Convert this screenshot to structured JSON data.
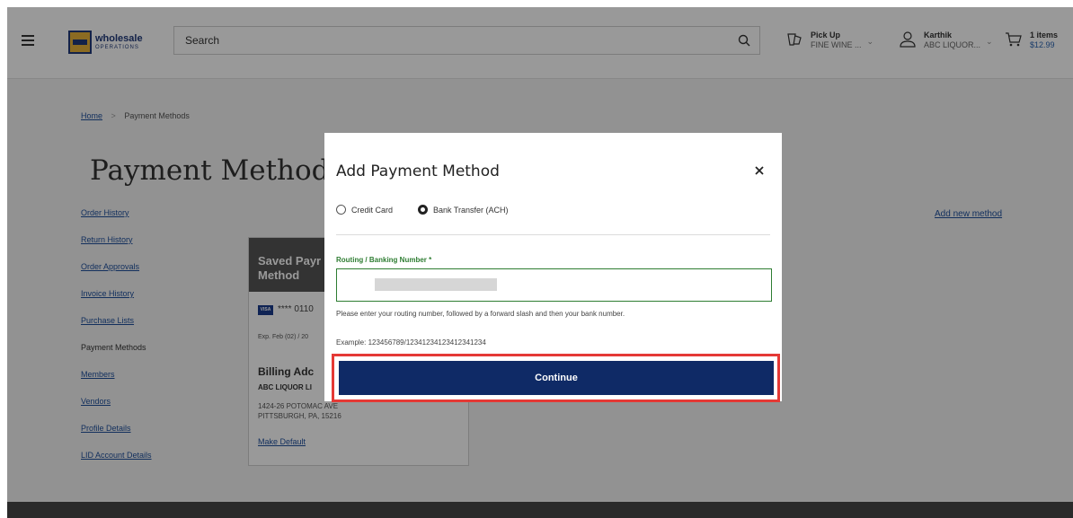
{
  "header": {
    "logo": {
      "title": "wholesale",
      "subtitle": "OPERATIONS",
      "mark": "LCB"
    },
    "search": {
      "placeholder": "Search"
    },
    "pickup": {
      "title": "Pick Up",
      "store": "FINE WINE ..."
    },
    "account": {
      "name": "Karthik",
      "company": "ABC LIQUOR..."
    },
    "cart": {
      "count": "1 items",
      "total": "$12.99"
    }
  },
  "breadcrumb": {
    "home": "Home",
    "separator": ">",
    "current": "Payment Methods"
  },
  "page": {
    "title": "Payment Methods",
    "add_new": "Add new method"
  },
  "side_nav": [
    {
      "label": "Order History"
    },
    {
      "label": "Return History"
    },
    {
      "label": "Order Approvals"
    },
    {
      "label": "Invoice History"
    },
    {
      "label": "Purchase Lists"
    },
    {
      "label": "Payment Methods",
      "active": true
    },
    {
      "label": "Members"
    },
    {
      "label": "Vendors"
    },
    {
      "label": "Profile Details"
    },
    {
      "label": "LID Account Details"
    }
  ],
  "saved_card": {
    "heading": "Saved Payment Method",
    "heading_visible": "Saved Payr\nMethod",
    "brand": "VISA",
    "masked": "**** 0110",
    "expiry": "Exp. Feb (02) / 20",
    "billing_heading": "Billing Adc",
    "billing_name": "ABC LIQUOR LI",
    "address_line1": "1424-26 POTOMAC AVE",
    "address_line2": "PITTSBURGH, PA, 15216",
    "make_default": "Make Default"
  },
  "modal": {
    "title": "Add Payment Method",
    "close_icon": "close-icon",
    "options": [
      {
        "label": "Credit Card",
        "selected": false
      },
      {
        "label": "Bank Transfer (ACH)",
        "selected": true
      }
    ],
    "field_label": "Routing / Banking Number *",
    "field_value": "",
    "hint": "Please enter your routing number, followed by a forward slash and then your bank number.",
    "example": "Example: 123456789/12341234123412341234",
    "continue_label": "Continue"
  },
  "colors": {
    "primary_button": "#0f2a66",
    "valid_field": "#2e7d32",
    "highlight": "#e53935",
    "link": "#1e4f9c"
  }
}
